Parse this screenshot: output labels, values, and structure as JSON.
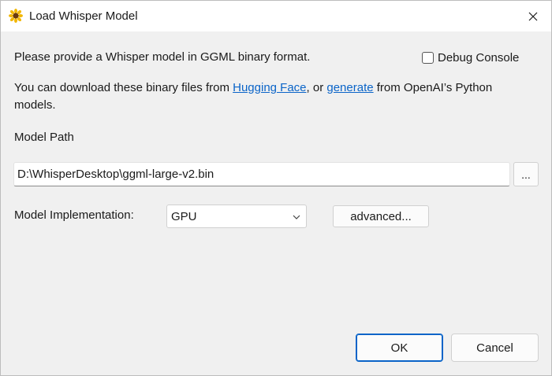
{
  "window": {
    "title": "Load Whisper Model",
    "app_icon": "sunflower-icon",
    "close_icon": "close-icon"
  },
  "intro": {
    "text": "Please provide a Whisper model in GGML binary format."
  },
  "debug_console": {
    "label": "Debug Console",
    "checked": false
  },
  "download": {
    "prefix": "You can download these binary files from ",
    "link1": "Hugging Face",
    "middle": ", or ",
    "link2": "generate",
    "suffix": " from OpenAI’s Python",
    "line2": "models."
  },
  "model_path": {
    "label": "Model Path",
    "value": "D:\\WhisperDesktop\\ggml-large-v2.bin",
    "browse_label": "..."
  },
  "implementation": {
    "label": "Model Implementation:",
    "selected": "GPU",
    "advanced_label": "advanced..."
  },
  "buttons": {
    "ok": "OK",
    "cancel": "Cancel"
  },
  "colors": {
    "accent": "#0a64c8",
    "background": "#f0f0f0"
  }
}
